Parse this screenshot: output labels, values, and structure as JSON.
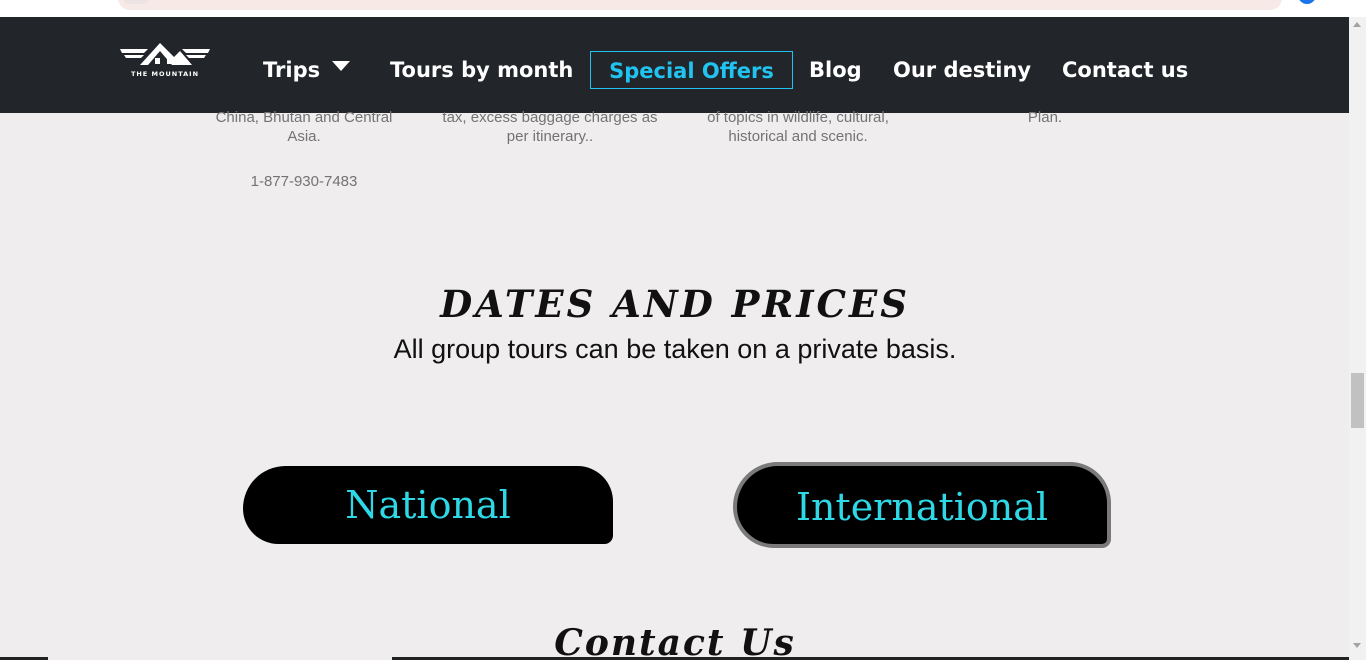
{
  "nav": {
    "logo_text": "THE MOUNTAIN",
    "items": [
      {
        "label": "Trips"
      },
      {
        "label": "Tours by month"
      },
      {
        "label": "Special Offers"
      },
      {
        "label": "Blog"
      },
      {
        "label": "Our destiny"
      },
      {
        "label": "Contact us"
      }
    ],
    "active_color": "#21c4f0"
  },
  "features": [
    {
      "text": "China, Bhutan and Central Asia."
    },
    {
      "text": "tax, excess baggage charges as per itinerary.."
    },
    {
      "text": "of topics in wildlife, cultural, historical and scenic."
    },
    {
      "text": "Plan."
    }
  ],
  "phone": "1-877-930-7483",
  "dates_prices": {
    "title": "DATES AND PRICES",
    "subtitle": "All group tours can be taken on a private basis.",
    "buttons": [
      {
        "label": "National"
      },
      {
        "label": "International"
      }
    ],
    "button_text_color": "#2fd8e6"
  },
  "contact_heading": "Contact Us"
}
